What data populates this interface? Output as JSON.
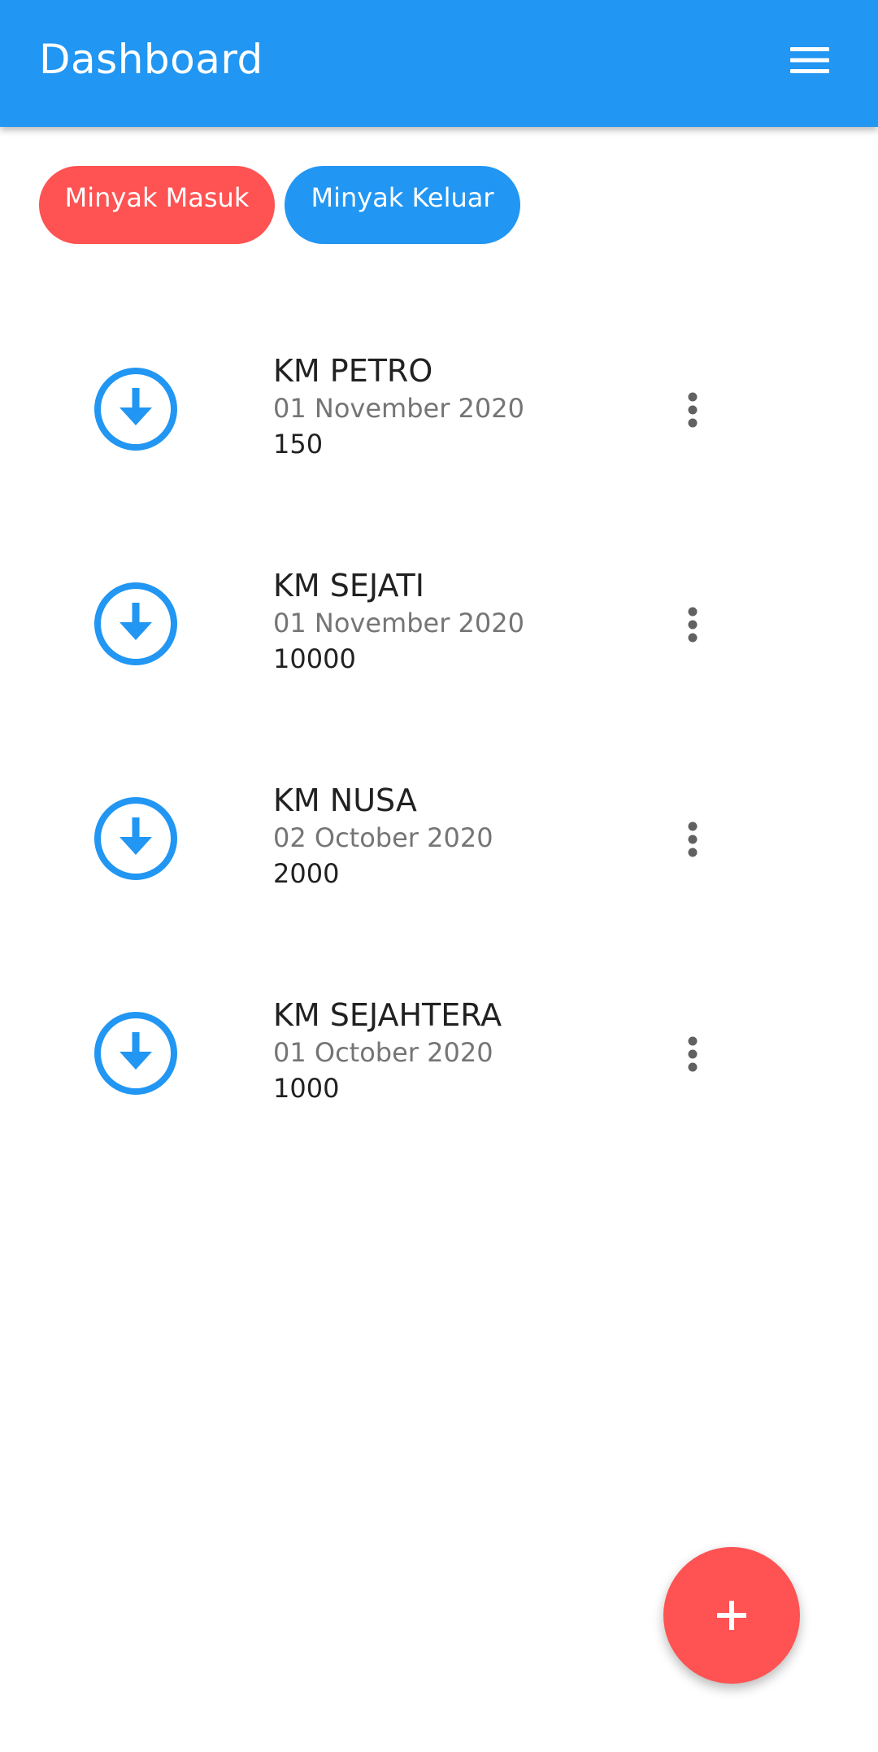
{
  "appbar": {
    "title": "Dashboard",
    "menu_icon": "menu-icon",
    "color": "#2196F3"
  },
  "tabs": [
    {
      "label": "Minyak Masuk",
      "color": "#FF5252"
    },
    {
      "label": "Minyak Keluar",
      "color": "#2196F3"
    }
  ],
  "items": [
    {
      "title": "KM PETRO",
      "date": "01 November 2020",
      "amount": "150",
      "icon": "arrow-circle-down-icon"
    },
    {
      "title": "KM SEJATI",
      "date": "01 November 2020",
      "amount": "10000",
      "icon": "arrow-circle-down-icon"
    },
    {
      "title": "KM NUSA",
      "date": "02 October 2020",
      "amount": "2000",
      "icon": "arrow-circle-down-icon"
    },
    {
      "title": "KM SEJAHTERA",
      "date": "01 October 2020",
      "amount": "1000",
      "icon": "arrow-circle-down-icon"
    }
  ],
  "fab": {
    "icon": "plus-icon",
    "color": "#FF5252"
  }
}
